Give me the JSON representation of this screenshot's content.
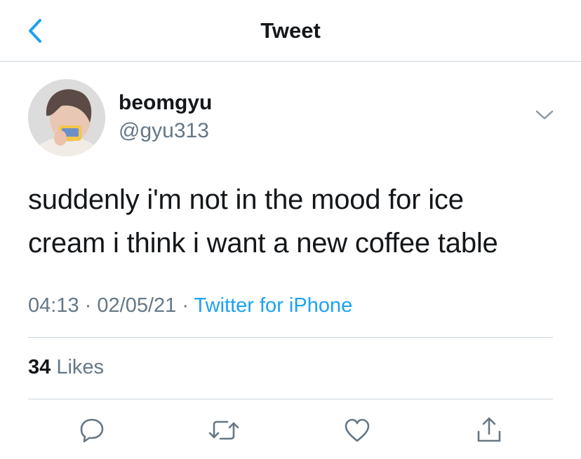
{
  "header": {
    "title": "Tweet",
    "back_icon": "chevron-left-icon"
  },
  "tweet": {
    "author": {
      "display_name": "beomgyu",
      "handle": "@gyu313"
    },
    "text_line1": "suddenly i'm not in the mood for ice",
    "text_line2": "cream i think i want a new coffee table",
    "time": "04:13",
    "separator": "·",
    "date": "02/05/21",
    "source": "Twitter for iPhone",
    "likes_count": "34",
    "likes_label": "Likes"
  },
  "actions": [
    "reply-icon",
    "retweet-icon",
    "like-icon",
    "share-icon"
  ],
  "colors": {
    "accent": "#1da1f2",
    "secondary_text": "#657786",
    "divider": "#ccd6dd"
  }
}
